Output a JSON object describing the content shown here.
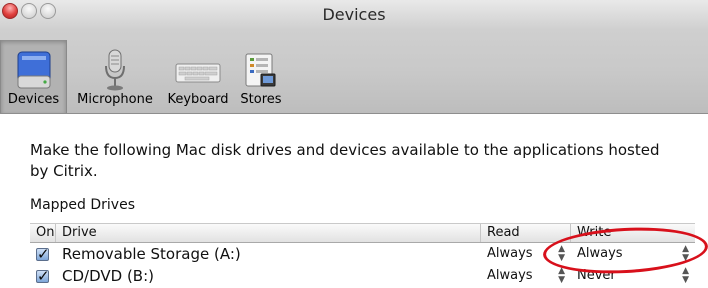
{
  "window": {
    "title": "Devices",
    "traffic_lights": [
      "close",
      "minimize",
      "zoom"
    ]
  },
  "toolbar": {
    "tabs": [
      {
        "label": "Devices",
        "icon": "hard-drive-icon",
        "selected": true
      },
      {
        "label": "Microphone",
        "icon": "microphone-icon",
        "selected": false
      },
      {
        "label": "Keyboard",
        "icon": "keyboard-icon",
        "selected": false
      },
      {
        "label": "Stores",
        "icon": "stores-icon",
        "selected": false
      }
    ]
  },
  "main": {
    "intro_text": "Make the following Mac disk drives and devices available to the applications hosted by Citrix.",
    "section_title": "Mapped Drives",
    "table": {
      "columns": [
        "On",
        "Drive",
        "Read",
        "Write"
      ],
      "rows": [
        {
          "on": true,
          "drive": "Removable Storage (A:)",
          "read": "Always",
          "write": "Always"
        },
        {
          "on": true,
          "drive": "CD/DVD (B:)",
          "read": "Always",
          "write": "Never"
        }
      ]
    }
  },
  "colors": {
    "annotation_circle": "#d8101b",
    "close_button": "#e0413f"
  }
}
